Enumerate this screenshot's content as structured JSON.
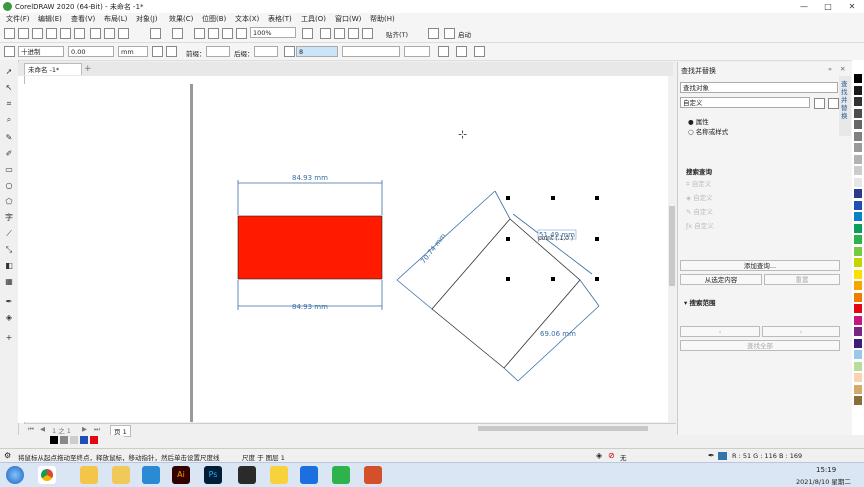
{
  "window": {
    "title": "CorelDRAW 2020 (64-Bit) - 未命名 -1*"
  },
  "menu": [
    "文件(F)",
    "编辑(E)",
    "查看(V)",
    "布局(L)",
    "对象(J)",
    "效果(C)",
    "位图(B)",
    "文本(X)",
    "表格(T)",
    "工具(O)",
    "窗口(W)",
    "帮助(H)"
  ],
  "toolbar": {
    "zoom": "100%",
    "snap_label": "贴齐(T)",
    "launch_label": "启动"
  },
  "property_bar": {
    "style": "十进制",
    "value": "0.00",
    "unit": "mm",
    "prefix_label": "前缀：",
    "suffix_label": "后缀：",
    "font_size": "8",
    "text_style": "默认"
  },
  "document": {
    "tab": "未命名 -1*"
  },
  "canvas": {
    "dim_top": "84.93 mm",
    "dim_bottom": "84.93 mm",
    "dim_left_rot": "70.74 mm",
    "dim_right_rot": "69.06 mm",
    "dim_selected": "51.49 mm",
    "selected_text": "point (.1,0 )",
    "rect_color": "#ff1a00"
  },
  "dock": {
    "header": "查找并替换",
    "find_select": "查找对象",
    "custom_select": "自定义",
    "radio_prop": "属性",
    "radio_name": "名称或样式",
    "search_query_label": "搜索查询",
    "query_items": [
      "自定义",
      "自定义",
      "自定义",
      "自定义"
    ],
    "add_query_btn": "添加查询...",
    "from_selection_btn": "从选定内容",
    "reset_btn": "重置",
    "search_scope_label": "搜索范围",
    "find_all_btn": "查找全部",
    "side_tab": "查找并替换"
  },
  "page_nav": {
    "page_label": "页 1",
    "page_counter": "1 之 1"
  },
  "status": {
    "hint": "将鼠标从起点拖动至终点，释放鼠标，移动指针，然后单击设置尺度线",
    "layer": "尺度 于 图层 1",
    "fill": "无",
    "color_info": "R : 51 G : 116 B : 169",
    "color_swatch": "#3374a9"
  },
  "taskbar": {
    "time": "15:19",
    "date": "2021/8/10 星期二"
  },
  "palette": [
    "#000000",
    "#1a1a1a",
    "#333333",
    "#4d4d4d",
    "#666666",
    "#808080",
    "#999999",
    "#b3b3b3",
    "#cccccc",
    "#e6e6e6",
    "#2b3a8a",
    "#1f4fb5",
    "#0a80c9",
    "#0a9f5a",
    "#2bb24c",
    "#7ac943",
    "#c8d400",
    "#ffdd00",
    "#f7a600",
    "#ef7d00",
    "#e30613",
    "#c7177f",
    "#7b2582",
    "#3d1f7a",
    "#99c8e8",
    "#b8dd9a",
    "#f9d2b0",
    "#d6a86a",
    "#8a6d3b",
    "#ffffff"
  ]
}
